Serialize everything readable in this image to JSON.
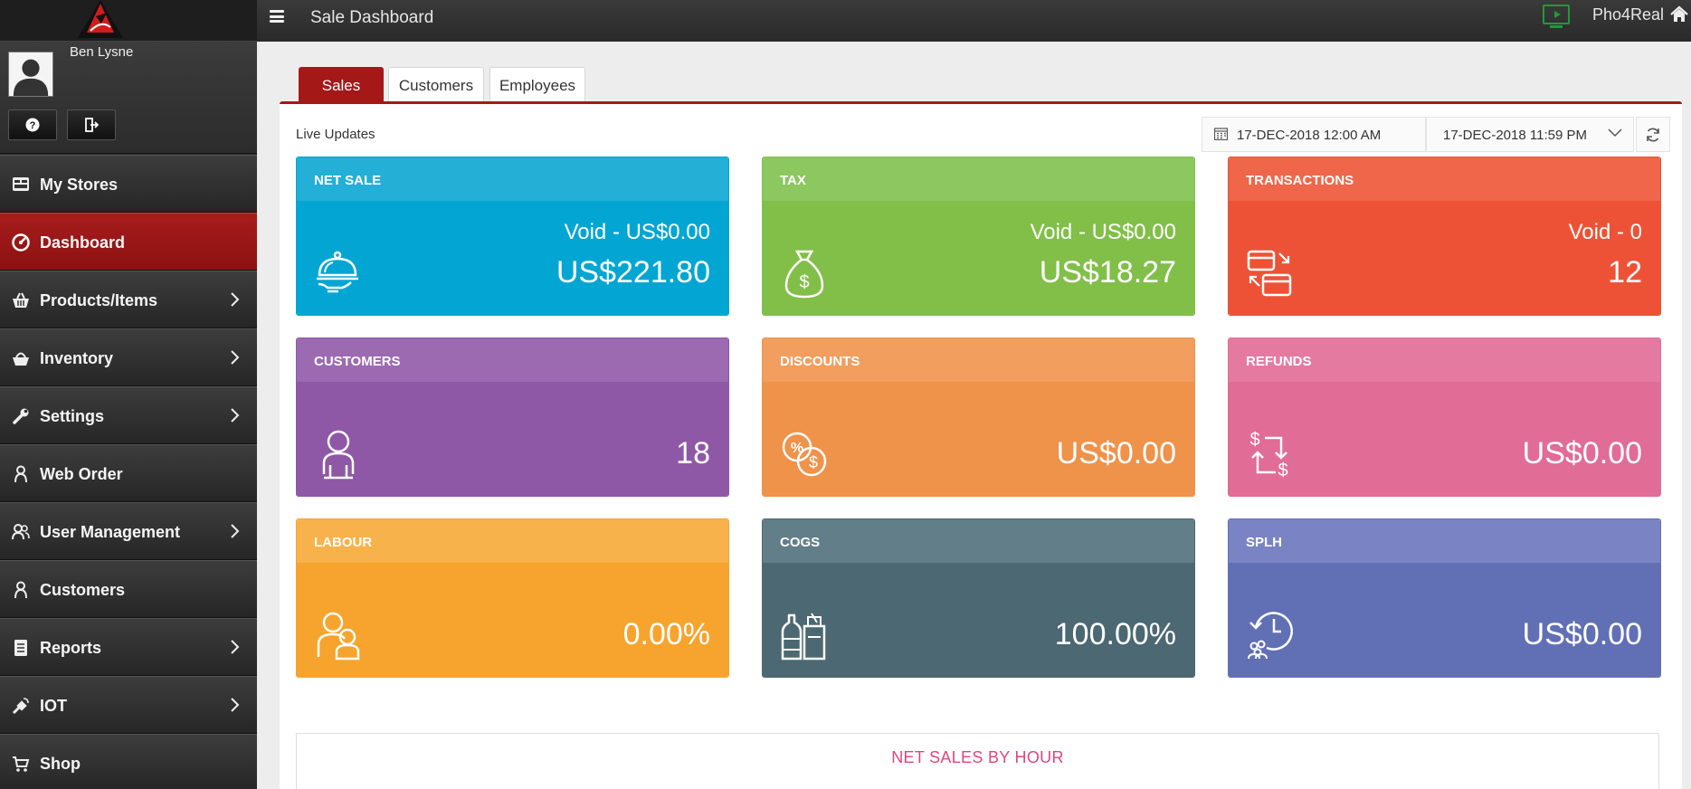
{
  "header": {
    "title": "Sale Dashboard",
    "brand": "Pho4Real"
  },
  "sidebar": {
    "user_name": "Ben Lysne",
    "items": [
      {
        "label": "My Stores",
        "icon": "store-icon",
        "has_submenu": false,
        "active": false
      },
      {
        "label": "Dashboard",
        "icon": "dashboard-icon",
        "has_submenu": false,
        "active": true
      },
      {
        "label": "Products/Items",
        "icon": "basket-icon",
        "has_submenu": true,
        "active": false
      },
      {
        "label": "Inventory",
        "icon": "inventory-basket-icon",
        "has_submenu": true,
        "active": false
      },
      {
        "label": "Settings",
        "icon": "wrench-icon",
        "has_submenu": true,
        "active": false
      },
      {
        "label": "Web Order",
        "icon": "web-order-person-icon",
        "has_submenu": false,
        "active": false
      },
      {
        "label": "User Management",
        "icon": "users-icon",
        "has_submenu": true,
        "active": false
      },
      {
        "label": "Customers",
        "icon": "customer-person-icon",
        "has_submenu": false,
        "active": false
      },
      {
        "label": "Reports",
        "icon": "report-icon",
        "has_submenu": true,
        "active": false
      },
      {
        "label": "IOT",
        "icon": "iot-icon",
        "has_submenu": true,
        "active": false
      },
      {
        "label": "Shop",
        "icon": "cart-icon",
        "has_submenu": false,
        "active": false
      }
    ]
  },
  "tabs": [
    "Sales",
    "Customers",
    "Employees"
  ],
  "live_updates": "Live Updates",
  "date_range": {
    "start": "17-DEC-2018 12:00 AM",
    "end": "17-DEC-2018 11:59 PM"
  },
  "cards": [
    {
      "title": "NET SALE",
      "void": "Void - US$0.00",
      "value": "US$221.80",
      "icon": "serving-cloche-icon",
      "head_color": "#23afd6",
      "body_color": "#03a6d3"
    },
    {
      "title": "TAX",
      "void": "Void - US$0.00",
      "value": "US$18.27",
      "icon": "money-bag-icon",
      "head_color": "#8cc75f",
      "body_color": "#81bf48"
    },
    {
      "title": "TRANSACTIONS",
      "void": "Void - 0",
      "value": "12",
      "icon": "transaction-cards-icon",
      "head_color": "#ef664a",
      "body_color": "#ee5236"
    },
    {
      "title": "CUSTOMERS",
      "void": "",
      "value": "18",
      "icon": "customer-icon",
      "head_color": "#9b6ab1",
      "body_color": "#8f58a6"
    },
    {
      "title": "DISCOUNTS",
      "void": "",
      "value": "US$0.00",
      "icon": "discount-coins-icon",
      "head_color": "#f19e5e",
      "body_color": "#ef924a"
    },
    {
      "title": "REFUNDS",
      "void": "",
      "value": "US$0.00",
      "icon": "refund-arrows-icon",
      "head_color": "#e57aa0",
      "body_color": "#e16c95"
    },
    {
      "title": "LABOUR",
      "void": "",
      "value": "0.00%",
      "icon": "labour-people-icon",
      "head_color": "#f7b24b",
      "body_color": "#f6a42e"
    },
    {
      "title": "COGS",
      "void": "",
      "value": "100.00%",
      "icon": "groceries-icon",
      "head_color": "#627e89",
      "body_color": "#4c6872"
    },
    {
      "title": "SPLH",
      "void": "",
      "value": "US$0.00",
      "icon": "clock-people-icon",
      "head_color": "#7a84c4",
      "body_color": "#6170b4"
    }
  ],
  "chart_section": {
    "title": "NET SALES BY HOUR"
  }
}
